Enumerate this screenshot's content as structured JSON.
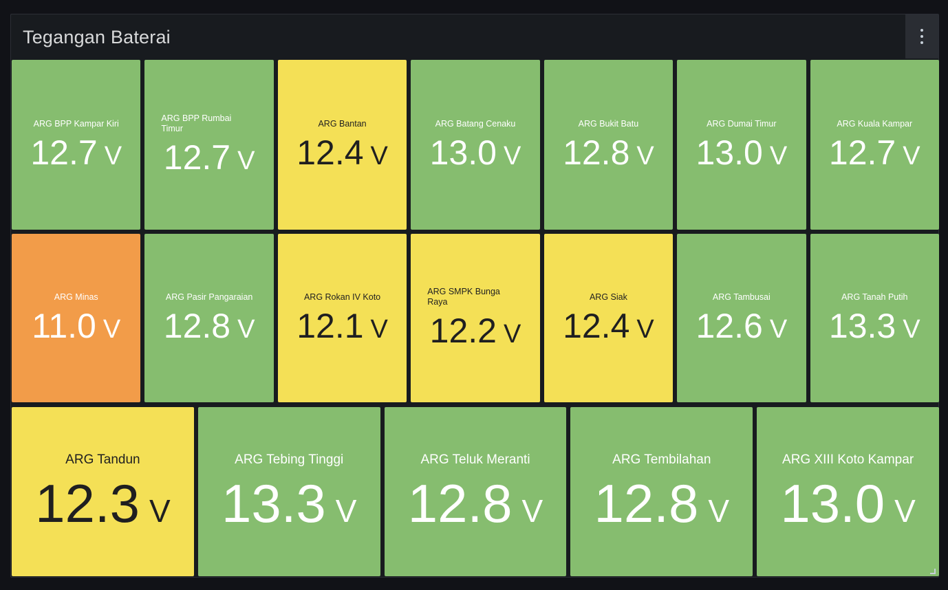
{
  "panel": {
    "title": "Tegangan Baterai",
    "menu_icon": "kebab-menu-icon",
    "resize_icon": "resize-handle-icon"
  },
  "colors": {
    "ok": "#86bd6f",
    "warning": "#f4e056",
    "critical": "#f29c49",
    "background": "#181b1f"
  },
  "unit": "V",
  "stations": [
    {
      "name": "ARG BPP Kampar Kiri",
      "value": "12.7",
      "status": "ok"
    },
    {
      "name": "ARG BPP Rumbai Timur",
      "value": "12.7",
      "status": "ok"
    },
    {
      "name": "ARG Bantan",
      "value": "12.4",
      "status": "warning"
    },
    {
      "name": "ARG Batang Cenaku",
      "value": "13.0",
      "status": "ok"
    },
    {
      "name": "ARG Bukit Batu",
      "value": "12.8",
      "status": "ok"
    },
    {
      "name": "ARG Dumai Timur",
      "value": "13.0",
      "status": "ok"
    },
    {
      "name": "ARG Kuala Kampar",
      "value": "12.7",
      "status": "ok"
    },
    {
      "name": "ARG Minas",
      "value": "11.0",
      "status": "critical"
    },
    {
      "name": "ARG Pasir Pangaraian",
      "value": "12.8",
      "status": "ok"
    },
    {
      "name": "ARG Rokan IV Koto",
      "value": "12.1",
      "status": "warning"
    },
    {
      "name": "ARG SMPK Bunga Raya",
      "value": "12.2",
      "status": "warning"
    },
    {
      "name": "ARG Siak",
      "value": "12.4",
      "status": "warning"
    },
    {
      "name": "ARG Tambusai",
      "value": "12.6",
      "status": "ok"
    },
    {
      "name": "ARG Tanah Putih",
      "value": "13.3",
      "status": "ok"
    },
    {
      "name": "ARG Tandun",
      "value": "12.3",
      "status": "warning"
    },
    {
      "name": "ARG Tebing Tinggi",
      "value": "13.3",
      "status": "ok"
    },
    {
      "name": "ARG Teluk Meranti",
      "value": "12.8",
      "status": "ok"
    },
    {
      "name": "ARG Tembilahan",
      "value": "12.8",
      "status": "ok"
    },
    {
      "name": "ARG XIII Koto Kampar",
      "value": "13.0",
      "status": "ok"
    }
  ]
}
